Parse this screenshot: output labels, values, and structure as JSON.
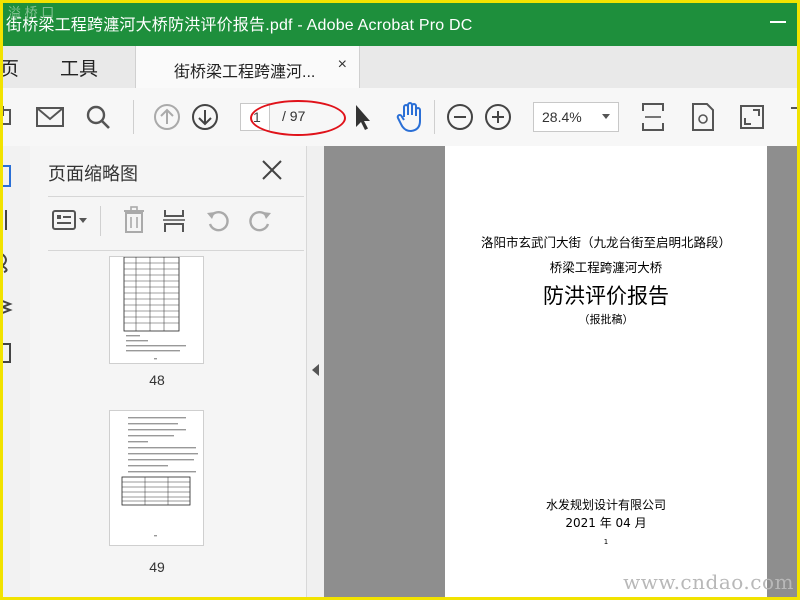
{
  "window": {
    "title": "街桥梁工程跨瀍河大桥防洪评价报告.pdf - Adobe Acrobat Pro DC",
    "watermark": "溢 桥 口"
  },
  "nav": {
    "home_label": "主页",
    "tools_label": "工具",
    "doc_tab_label": "街桥梁工程跨瀍河...",
    "doc_tab_close": "×"
  },
  "toolbar": {
    "current_page": "1",
    "total_pages": "/ 97",
    "zoom": "28.4%"
  },
  "panel": {
    "title": "页面缩略图",
    "thumbnails": [
      {
        "page_number": "48"
      },
      {
        "page_number": "49"
      }
    ]
  },
  "document": {
    "line1": "洛阳市玄武门大街（九龙台街至启明北路段）",
    "line2": "桥梁工程跨瀍河大桥",
    "title": "防洪评价报告",
    "subtitle": "（报批稿）",
    "company": "水发规划设计有限公司",
    "date": "2021 年 04 月",
    "page_footer": "1"
  },
  "site_watermark": "www.cndao.com",
  "colors": {
    "titlebar": "#1e8f3c",
    "frame": "#f2e300",
    "highlight_ellipse": "#e0121a",
    "hand_tool": "#2a6fd6"
  }
}
